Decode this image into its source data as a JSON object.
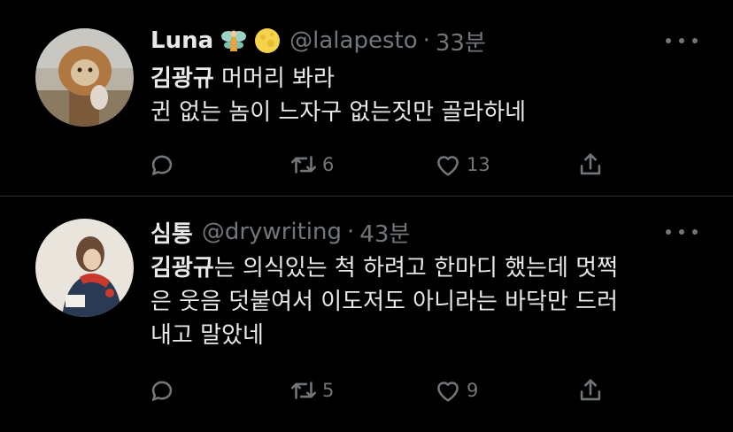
{
  "tweets": [
    {
      "author_name": "Luna",
      "handle": "@lalapesto",
      "separator": "·",
      "time": "33분",
      "emojis": [
        "fairy-emoji",
        "full-moon-emoji"
      ],
      "mention": "김광규",
      "body_line1_rest": " 머머리 봐라",
      "body_line2": "귄 없는 놈이 느자구 없는짓만 골라하네",
      "retweet_count": "6",
      "like_count": "13"
    },
    {
      "author_name": "심통",
      "handle": "@drywriting",
      "separator": "·",
      "time": "43분",
      "mention": "김광규",
      "body_line1_rest": "는 의식있는 척 하려고 한마디 했는데 멋쩍",
      "body_line2": "은 웃음 덧붙여서 이도저도 아니라는 바닥만 드러",
      "body_line3": "내고 말았네",
      "retweet_count": "5",
      "like_count": "9"
    }
  ],
  "icons": {
    "reply": "reply-icon",
    "retweet": "retweet-icon",
    "like": "like-icon",
    "share": "share-icon",
    "more": "more-icon"
  },
  "colors": {
    "background": "#000000",
    "text": "#e7e9ea",
    "secondary": "#71767b",
    "divider": "#2f3336"
  }
}
